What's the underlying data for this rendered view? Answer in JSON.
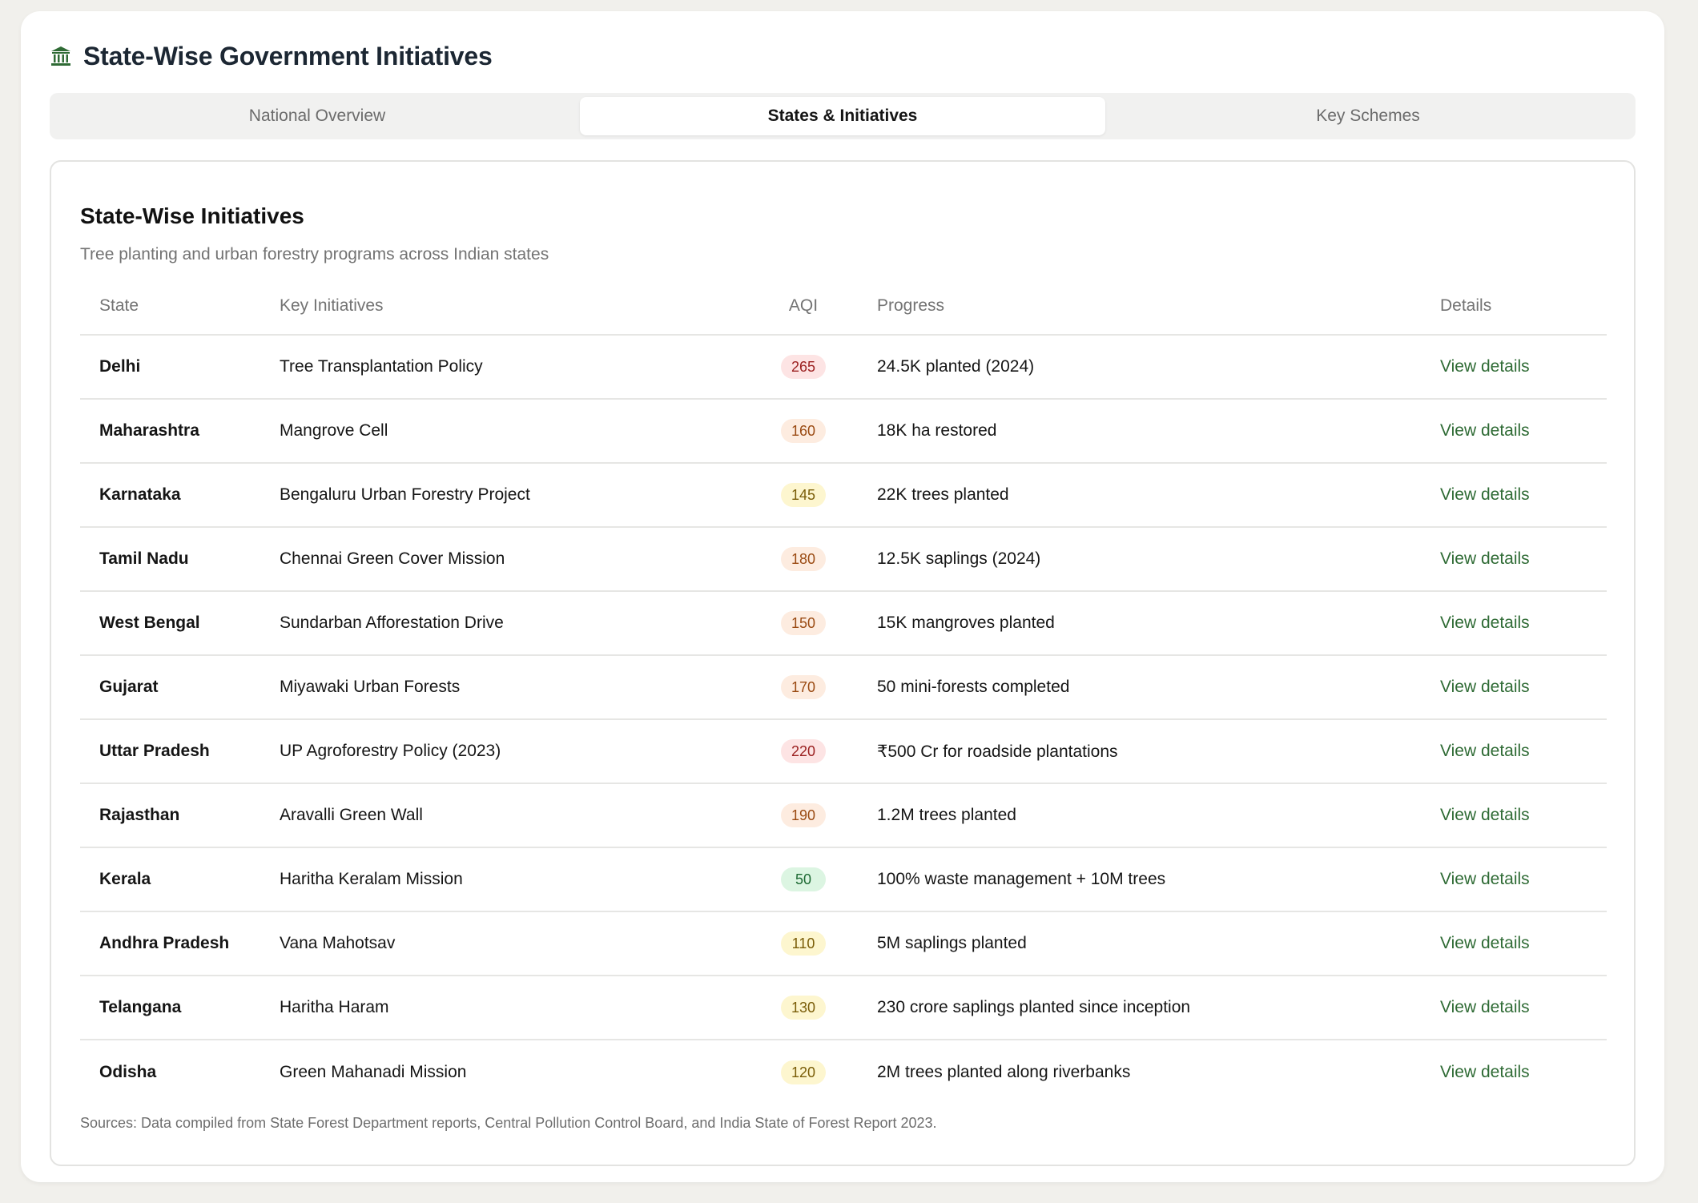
{
  "header": {
    "title": "State-Wise Government Initiatives",
    "icon": "bank-building-icon"
  },
  "tabs": [
    {
      "label": "National Overview",
      "active": false
    },
    {
      "label": "States & Initiatives",
      "active": true
    },
    {
      "label": "Key Schemes",
      "active": false
    }
  ],
  "panel": {
    "title": "State-Wise Initiatives",
    "subtitle": "Tree planting and urban forestry programs across Indian states",
    "columns": {
      "state": "State",
      "initiatives": "Key Initiatives",
      "aqi": "AQI",
      "progress": "Progress",
      "details": "Details"
    },
    "rows": [
      {
        "state": "Delhi",
        "initiative": "Tree Transplantation Policy",
        "aqi": "265",
        "aqi_level": "red",
        "progress": "24.5K planted (2024)",
        "details": "View details"
      },
      {
        "state": "Maharashtra",
        "initiative": "Mangrove Cell",
        "aqi": "160",
        "aqi_level": "orange",
        "progress": "18K ha restored",
        "details": "View details"
      },
      {
        "state": "Karnataka",
        "initiative": "Bengaluru Urban Forestry Project",
        "aqi": "145",
        "aqi_level": "yellow",
        "progress": "22K trees planted",
        "details": "View details"
      },
      {
        "state": "Tamil Nadu",
        "initiative": "Chennai Green Cover Mission",
        "aqi": "180",
        "aqi_level": "orange",
        "progress": "12.5K saplings (2024)",
        "details": "View details"
      },
      {
        "state": "West Bengal",
        "initiative": "Sundarban Afforestation Drive",
        "aqi": "150",
        "aqi_level": "orange",
        "progress": "15K mangroves planted",
        "details": "View details"
      },
      {
        "state": "Gujarat",
        "initiative": "Miyawaki Urban Forests",
        "aqi": "170",
        "aqi_level": "orange",
        "progress": "50 mini-forests completed",
        "details": "View details"
      },
      {
        "state": "Uttar Pradesh",
        "initiative": "UP Agroforestry Policy (2023)",
        "aqi": "220",
        "aqi_level": "red",
        "progress": "₹500 Cr for roadside plantations",
        "details": "View details"
      },
      {
        "state": "Rajasthan",
        "initiative": "Aravalli Green Wall",
        "aqi": "190",
        "aqi_level": "orange",
        "progress": "1.2M trees planted",
        "details": "View details"
      },
      {
        "state": "Kerala",
        "initiative": "Haritha Keralam Mission",
        "aqi": "50",
        "aqi_level": "green",
        "progress": "100% waste management + 10M trees",
        "details": "View details"
      },
      {
        "state": "Andhra Pradesh",
        "initiative": "Vana Mahotsav",
        "aqi": "110",
        "aqi_level": "yellow",
        "progress": "5M saplings planted",
        "details": "View details"
      },
      {
        "state": "Telangana",
        "initiative": "Haritha Haram",
        "aqi": "130",
        "aqi_level": "yellow",
        "progress": "230 crore saplings planted since inception",
        "details": "View details"
      },
      {
        "state": "Odisha",
        "initiative": "Green Mahanadi Mission",
        "aqi": "120",
        "aqi_level": "yellow",
        "progress": "2M trees planted along riverbanks",
        "details": "View details"
      }
    ],
    "sources": "Sources: Data compiled from State Forest Department reports, Central Pollution Control Board, and India State of Forest Report 2023."
  },
  "colors": {
    "accent_green": "#2f6b35",
    "aqi_red": "#fde4e4",
    "aqi_orange": "#fdece0",
    "aqi_yellow": "#fdf6cf",
    "aqi_green": "#dcf5e2"
  }
}
